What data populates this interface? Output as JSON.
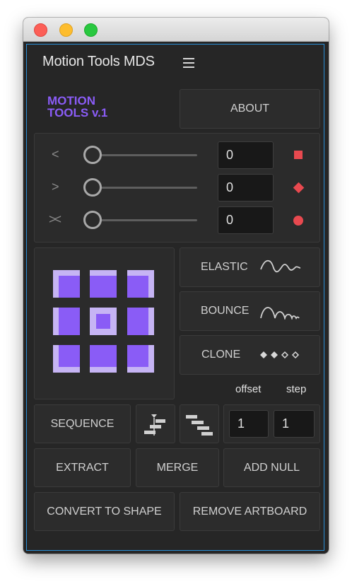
{
  "window": {
    "title": "Motion Tools MDS"
  },
  "brand": {
    "line1": "MOTION",
    "line2": "TOOLS v.1",
    "color": "#8a5cf6"
  },
  "buttons": {
    "about": "ABOUT",
    "elastic": "ELASTIC",
    "bounce": "BOUNCE",
    "clone": "CLONE",
    "sequence": "SEQUENCE",
    "extract": "EXTRACT",
    "merge": "MERGE",
    "add_null": "ADD NULL",
    "convert_to_shape": "CONVERT TO SHAPE",
    "remove_artboard": "REMOVE ARTBOARD"
  },
  "easing": {
    "rows": [
      {
        "icon": "ease-in-icon",
        "glyph": "<",
        "value": "0",
        "key_icon": "square-keyframe-icon",
        "slider": 0
      },
      {
        "icon": "ease-out-icon",
        "glyph": ">",
        "value": "0",
        "key_icon": "diamond-keyframe-icon",
        "slider": 0
      },
      {
        "icon": "ease-both-icon",
        "glyph": "><",
        "value": "0",
        "key_icon": "circle-keyframe-icon",
        "slider": 0
      }
    ],
    "keyframe_color": "#e8494f"
  },
  "sequence": {
    "offset_label": "offset",
    "step_label": "step",
    "offset_value": "1",
    "step_value": "1"
  },
  "colors": {
    "anchor_purple": "#8a5cf6",
    "anchor_light": "#c6b4f4",
    "panel_border": "#2a8fd6"
  }
}
